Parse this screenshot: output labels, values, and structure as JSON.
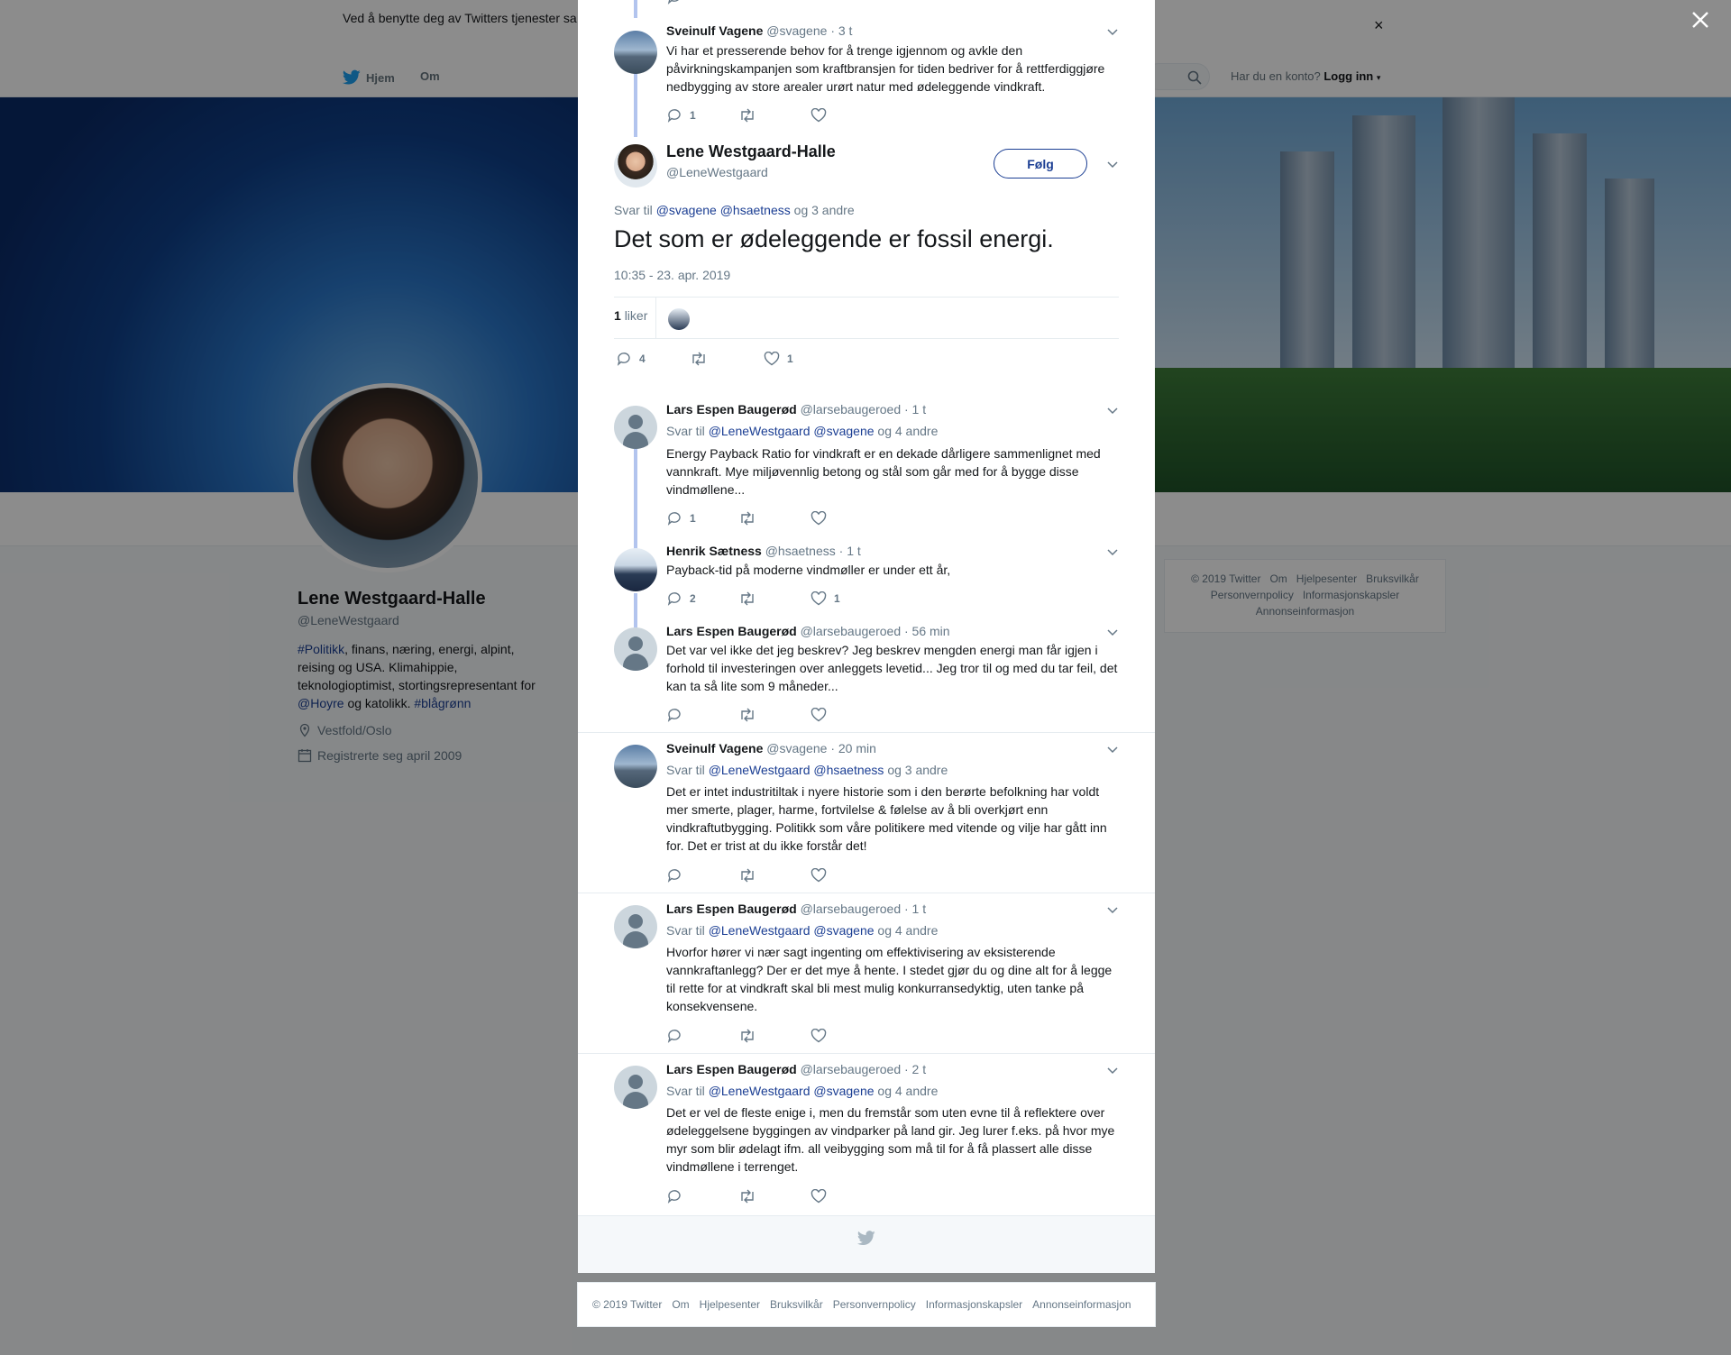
{
  "cookie_banner": {
    "text": "Ved å benytte deg av Twitters tjenester sa… informasjonskapsler til bl.a. analyser, personalisering og annonser.",
    "close_glyph": "×"
  },
  "nav": {
    "home": "Hjem",
    "about": "Om",
    "account_prompt": "Har du en konto?",
    "login": "Logg inn"
  },
  "profile": {
    "name": "Lene Westgaard-Halle",
    "handle": "@LeneWestgaard",
    "bio_tag1": "#Politikk",
    "bio_mid": ", finans, næring, energi, alpint, reising og USA. Klimahippie, teknologioptimist, stortingsrepresentant for ",
    "bio_mention": "@Hoyre",
    "bio_mid2": " og katolikk. ",
    "bio_tag2": "#blågrønn",
    "location": "Vestfold/Oslo",
    "joined": "Registrerte seg april 2009"
  },
  "side_footer": [
    "© 2019 Twitter",
    "Om",
    "Hjelpesenter",
    "Bruksvilkår",
    "Personvernpolicy",
    "Informasjonskapsler",
    "Annonseinformasjon"
  ],
  "thread": {
    "parent": {
      "name": "Sveinulf Vagene",
      "handle": "@svagene",
      "time": "· 3 t",
      "text": "Vi har et presserende behov for å trenge igjennom og avkle den påvirkningskampanjen som kraftbransjen for tiden bedriver for å rettferdiggjøre nedbygging av store arealer urørt natur med ødeleggende vindkraft.",
      "replies": "1"
    },
    "main": {
      "name": "Lene Westgaard-Halle",
      "handle": "@LeneWestgaard",
      "follow": "Følg",
      "reply_prefix": "Svar til",
      "reply_mentions": "@svagene @hsaetness",
      "reply_suffix": "og 3 andre",
      "text": "Det som er ødeleggende er fossil energi.",
      "timestamp": "10:35 - 23. apr. 2019",
      "likes_count": "1",
      "likes_label": "liker",
      "reply_count": "4",
      "like_count": "1"
    },
    "replies": [
      {
        "name": "Lars Espen Baugerød",
        "handle": "@larsebaugeroed",
        "time": "· 1 t",
        "reply_prefix": "Svar til",
        "reply_mentions": "@LeneWestgaard @svagene",
        "reply_suffix": "og 4 andre",
        "text": "Energy Payback Ratio for vindkraft er en dekade dårligere sammenlignet med vannkraft. Mye miljøvennlig betong og stål som går med for å bygge disse vindmøllene...",
        "replies": "1",
        "likes": ""
      },
      {
        "name": "Henrik Sætness",
        "handle": "@hsaetness",
        "time": "· 1 t",
        "text": "Payback-tid på moderne vindmøller er under ett år,",
        "replies": "2",
        "likes": "1"
      },
      {
        "name": "Lars Espen Baugerød",
        "handle": "@larsebaugeroed",
        "time": "· 56 min",
        "text": "Det var vel ikke det jeg beskrev?   Jeg beskrev mengden energi man får igjen i forhold til investeringen over anleggets levetid... Jeg tror til og med du tar feil, det kan ta så lite som 9 måneder...",
        "replies": "",
        "likes": ""
      },
      {
        "name": "Sveinulf Vagene",
        "handle": "@svagene",
        "time": "· 20 min",
        "reply_prefix": "Svar til",
        "reply_mentions": "@LeneWestgaard @hsaetness",
        "reply_suffix": "og 3 andre",
        "text": "Det er intet industritiltak i nyere historie som i den berørte befolkning har voldt mer smerte, plager, harme, fortvilelse & følelse av å bli overkjørt enn vindkraftutbygging. Politikk som våre politikere med vitende og vilje har gått inn for. Det er trist at du ikke forstår det!",
        "replies": "",
        "likes": ""
      },
      {
        "name": "Lars Espen Baugerød",
        "handle": "@larsebaugeroed",
        "time": "· 1 t",
        "reply_prefix": "Svar til",
        "reply_mentions": "@LeneWestgaard @svagene",
        "reply_suffix": "og 4 andre",
        "text": "Hvorfor hører vi nær sagt ingenting om effektivisering av eksisterende vannkraftanlegg? Der er det mye å hente. I stedet gjør du og dine alt for å legge til rette for at vindkraft skal bli mest mulig konkurransedyktig, uten tanke på konsekvensene.",
        "replies": "",
        "likes": ""
      },
      {
        "name": "Lars Espen Baugerød",
        "handle": "@larsebaugeroed",
        "time": "· 2 t",
        "reply_prefix": "Svar til",
        "reply_mentions": "@LeneWestgaard @svagene",
        "reply_suffix": "og 4 andre",
        "text": "Det er vel de fleste enige i, men du fremstår som uten evne til å reflektere over ødeleggelsene byggingen av vindparker på land gir. Jeg lurer f.eks. på hvor mye myr som blir ødelagt ifm. all veibygging som må til for å få plassert alle disse vindmøllene i terrenget.",
        "replies": "",
        "likes": ""
      }
    ]
  },
  "bottom_footer": [
    "© 2019 Twitter",
    "Om",
    "Hjelpesenter",
    "Bruksvilkår",
    "Personvernpolicy",
    "Informasjonskapsler",
    "Annonseinformasjon"
  ],
  "colors": {
    "link": "#1b3e93",
    "thread_line": "#b2c4ee",
    "muted": "#657786",
    "twitter_blue": "#1da1f2"
  },
  "icons": [
    "twitter-bird-icon",
    "search-icon",
    "close-icon",
    "reply-icon",
    "retweet-icon",
    "like-icon",
    "chevron-down-icon",
    "location-icon",
    "calendar-icon"
  ]
}
